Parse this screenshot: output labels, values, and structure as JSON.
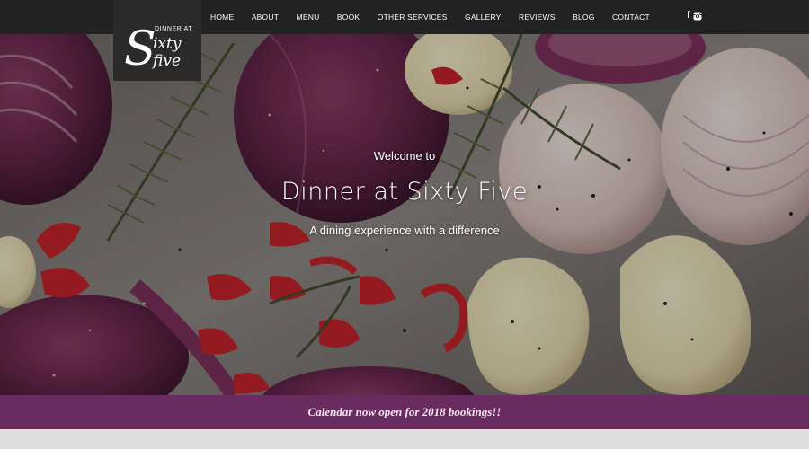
{
  "logo": {
    "line1": "DINNER AT",
    "word1": "ixty",
    "word2": "five",
    "initial": "S"
  },
  "nav": {
    "items": [
      "HOME",
      "ABOUT",
      "MENU",
      "BOOK",
      "OTHER SERVICES",
      "GALLERY",
      "REVIEWS",
      "BLOG",
      "CONTACT"
    ]
  },
  "social": {
    "facebook_glyph": "f",
    "facebook_icon": "facebook-icon",
    "instagram_icon": "instagram-icon"
  },
  "hero": {
    "welcome": "Welcome to",
    "title": "Dinner at Sixty Five",
    "tagline": "A dining experience with a difference"
  },
  "banner": {
    "text": "Calendar now open for 2018 bookings!!"
  },
  "colors": {
    "header_bg": "#222222",
    "banner_bg": "#6a2b5e",
    "accent_purple": "#5a2a4f"
  }
}
